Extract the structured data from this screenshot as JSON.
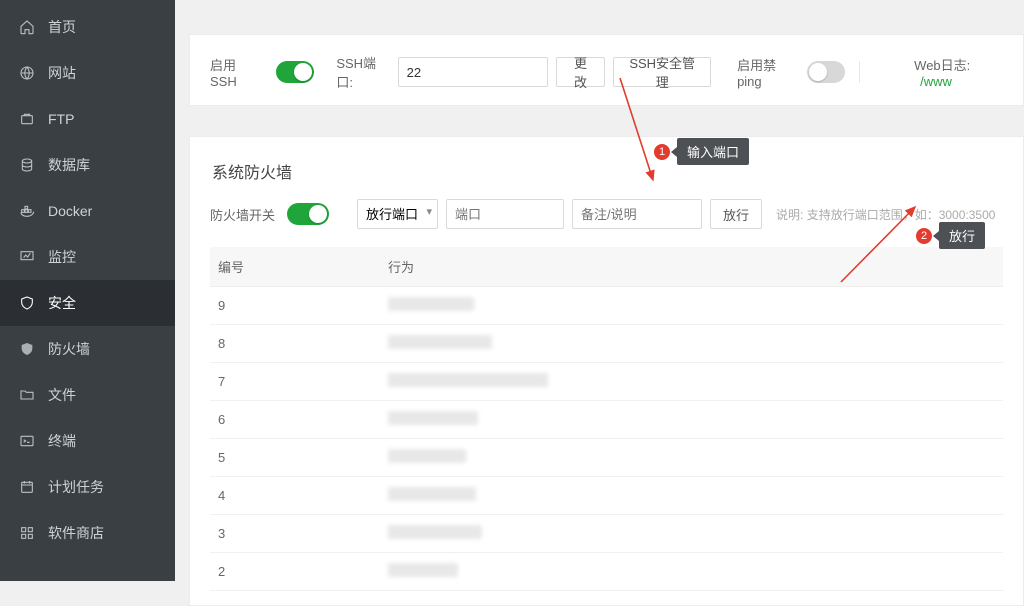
{
  "sidebar": {
    "items": [
      {
        "label": "首页",
        "name": "home"
      },
      {
        "label": "网站",
        "name": "site"
      },
      {
        "label": "FTP",
        "name": "ftp"
      },
      {
        "label": "数据库",
        "name": "database"
      },
      {
        "label": "Docker",
        "name": "docker"
      },
      {
        "label": "监控",
        "name": "monitor"
      },
      {
        "label": "安全",
        "name": "security",
        "active": true
      },
      {
        "label": "防火墙",
        "name": "firewall"
      },
      {
        "label": "文件",
        "name": "files"
      },
      {
        "label": "终端",
        "name": "terminal"
      },
      {
        "label": "计划任务",
        "name": "cron"
      },
      {
        "label": "软件商店",
        "name": "appstore"
      }
    ]
  },
  "topbar": {
    "ssh_label": "启用SSH",
    "ssh_on": true,
    "ssh_port_label": "SSH端口:",
    "ssh_port_value": "22",
    "ssh_modify_btn": "更改",
    "ssh_sec_mgmt_btn": "SSH安全管理",
    "ping_label": "启用禁ping",
    "ping_on": false,
    "weblog_label": "Web日志:",
    "weblog_value": "/www"
  },
  "section_title": "系统防火墙",
  "fw": {
    "switch_label": "防火墙开关",
    "switch_on": true,
    "type_select": "放行端口",
    "port_placeholder": "端口",
    "remark_placeholder": "备注/说明",
    "allow_btn": "放行",
    "hint": "说明: 支持放行端口范围，如：3000:3500"
  },
  "table": {
    "columns": [
      "编号",
      "行为"
    ],
    "rows": [
      {
        "no": "9",
        "actW": 86
      },
      {
        "no": "8",
        "actW": 104
      },
      {
        "no": "7",
        "actW": 160
      },
      {
        "no": "6",
        "actW": 90
      },
      {
        "no": "5",
        "actW": 78
      },
      {
        "no": "4",
        "actW": 88
      },
      {
        "no": "3",
        "actW": 94
      },
      {
        "no": "2",
        "actW": 70
      }
    ]
  },
  "annotations": {
    "step1_label": "输入端口",
    "step2_label": "放行"
  }
}
